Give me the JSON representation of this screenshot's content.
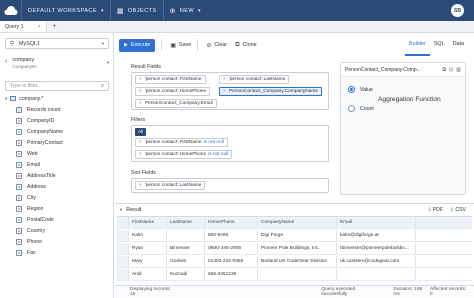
{
  "topbar": {
    "workspace": "DEFAULT WORKSPACE",
    "objects": "OBJECTS",
    "new": "NEW",
    "avatar": "SB"
  },
  "tabs": [
    {
      "label": "Query 1"
    }
  ],
  "left": {
    "connection": "MySQL1",
    "table_name": "company",
    "table_sub": "CompanyID",
    "search_placeholder": "Type to filter...",
    "root": "company.*",
    "fields": [
      "Records count",
      "CompanyID",
      "CompanyName",
      "PrimaryContact",
      "Web",
      "Email",
      "AddressTitle",
      "Address",
      "City",
      "Region",
      "PostalCode",
      "Country",
      "Phone",
      "Fax"
    ]
  },
  "toolbar": {
    "execute": "Execute",
    "save": "Save",
    "clear": "Clear",
    "clone": "Clone",
    "view_tabs": [
      "Builder",
      "SQL",
      "Data"
    ],
    "active_tab": "Builder"
  },
  "builder": {
    "result_fields_title": "Result Fields",
    "result_fields": [
      "'person contact'.FirstName",
      "'person contact'.LastName",
      "'person contact'.HomePhone",
      "PersonContact_Company.CompanyName",
      "PersonContact_Company.Email"
    ],
    "filters_title": "Filters",
    "filters_all": "All",
    "filters": [
      {
        "field": "'person contact'.FirstName",
        "op": "is not null"
      },
      {
        "field": "'person contact'.HomePhone",
        "op": "is not null"
      }
    ],
    "sort_title": "Sort Fields",
    "sort_fields": [
      "'person contact'.LastName"
    ]
  },
  "props": {
    "field": "PersonContact_Company.Comp...",
    "option_value": "Value",
    "option_count": "Count",
    "aggregation_title": "Aggregation Function",
    "selected": "Value"
  },
  "result": {
    "title": "Result",
    "pdf": "PDF",
    "csv": "CSV",
    "columns": [
      "FirstName",
      "LastName",
      "HomePhone",
      "CompanyName",
      "Email"
    ],
    "rows": [
      [
        "Kalm",
        "",
        "800-9496",
        "Digi Forge",
        "kalm@digiforge.at"
      ],
      [
        "Ryan",
        "Bimesser",
        "(868)-345-2905",
        "Pioneer Pole Buildings, Inc.",
        "rbimesser@pioneerpolebuildin..."
      ],
      [
        "Mary",
        "Godwin",
        "01403-222-0365",
        "Borland UK CodeGear Division",
        "uk.custserv@codegear.com"
      ],
      [
        "Andi",
        "Kuznadi",
        "566-3451239",
        "",
        ""
      ]
    ]
  },
  "status": {
    "displaying": "Displaying records: 15",
    "executed": "Query executed successfully",
    "duration": "Duration: 199 ms",
    "affected": "Affected records: 0"
  },
  "colors": {
    "topbar": "#2c4a78",
    "accent": "#2f6fd6"
  }
}
